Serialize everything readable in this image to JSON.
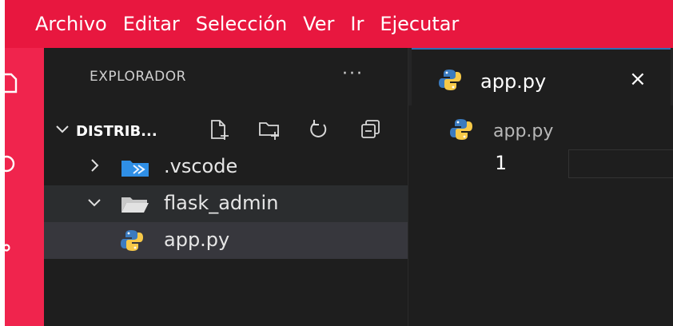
{
  "menubar": {
    "items": [
      "Archivo",
      "Editar",
      "Selección",
      "Ver",
      "Ir",
      "Ejecutar"
    ]
  },
  "sidebar": {
    "header": "EXPLORADOR",
    "more": "···",
    "root": {
      "label": "DISTRIB..."
    },
    "tree": [
      {
        "label": ".vscode",
        "expanded": false,
        "icon": "vscode-folder-icon"
      },
      {
        "label": "flask_admin",
        "expanded": true,
        "icon": "folder-open-icon"
      },
      {
        "label": "app.py",
        "icon": "python-icon"
      }
    ],
    "toolbar_icons": [
      "new-file-icon",
      "new-folder-icon",
      "refresh-icon",
      "collapse-all-icon"
    ]
  },
  "editor": {
    "tab": {
      "label": "app.py",
      "close": "×"
    },
    "breadcrumb": "app.py",
    "line_number": "1"
  },
  "colors": {
    "menubar": "#e8173f",
    "activitybar": "#f0244d",
    "sidebar": "#1e1e1e",
    "vscode_blue": "#2f8fe6",
    "python_blue": "#3b7bbf",
    "python_yellow": "#f7c948"
  }
}
